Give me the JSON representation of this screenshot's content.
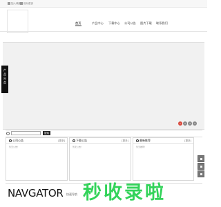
{
  "topbar": {
    "links": [
      "加入收藏",
      "设为首页"
    ]
  },
  "nav": {
    "items": [
      "首页",
      "产品中心",
      "下载中心",
      "公司公告",
      "图片下载",
      "联系我们"
    ]
  },
  "sidebar_tab": {
    "chars": [
      "产",
      "品",
      "分",
      "类"
    ]
  },
  "slider": {
    "dots": [
      "1",
      "2",
      "3",
      "4"
    ]
  },
  "search": {
    "placeholder": "",
    "button_label": "搜索"
  },
  "panels": [
    {
      "title": "公司公告",
      "more": "[更多]",
      "empty_text": "暂无公告！"
    },
    {
      "title": "下载公告",
      "more": "[更多]",
      "empty_text": "暂无公告！"
    },
    {
      "title": "最新推荐",
      "more": "[更多]",
      "empty_text": "暂无推荐！"
    }
  ],
  "footer": {
    "brand": "NAVGATOR",
    "subtitle": "快速导航"
  },
  "watermark": {
    "text": "秒收录啦",
    "color": "#33d35a"
  }
}
